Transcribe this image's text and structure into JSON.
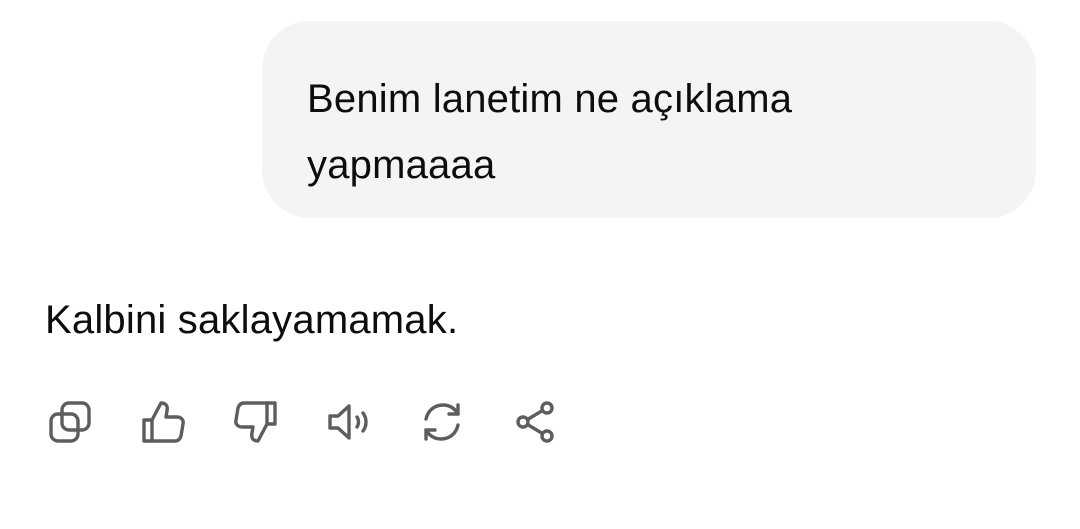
{
  "conversation": {
    "user_message": "Benim lanetim ne açıklama yapmaaaa",
    "assistant_message": "Kalbini saklayamamak."
  },
  "actions": [
    {
      "icon": "copy-icon"
    },
    {
      "icon": "thumbs-up-icon"
    },
    {
      "icon": "thumbs-down-icon"
    },
    {
      "icon": "speaker-icon"
    },
    {
      "icon": "regenerate-icon"
    },
    {
      "icon": "share-icon"
    }
  ],
  "colors": {
    "bubble_background": "#f4f4f4",
    "text": "#0d0d0d",
    "icon": "#5d5d5d"
  }
}
